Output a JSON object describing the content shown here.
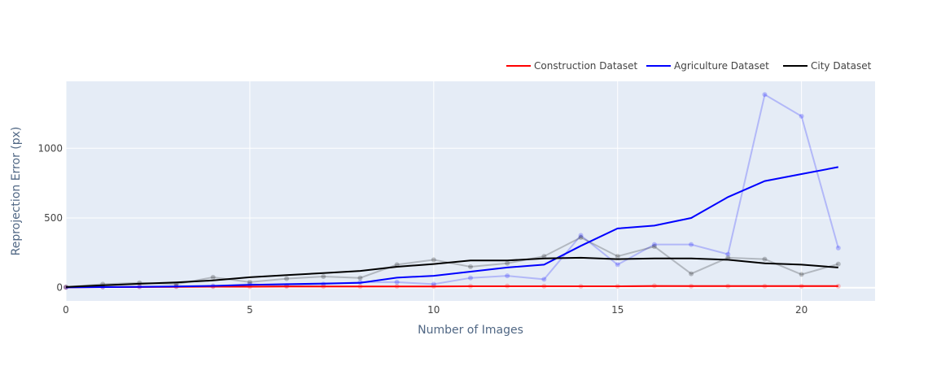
{
  "chart_data": {
    "type": "line",
    "title": "",
    "xlabel": "Number of Images",
    "ylabel": "Reprojection Error (px)",
    "xlim": [
      0,
      22
    ],
    "ylim": [
      -95,
      1480
    ],
    "xticks": [
      0,
      5,
      10,
      15,
      20
    ],
    "yticks": [
      0,
      500,
      1000
    ],
    "grid": true,
    "legend_placement": "top-right, horizontal",
    "colors": {
      "plot_bg": "#E5ECF6",
      "grid": "#FFFFFF",
      "construction": "#FF0000",
      "agriculture": "#0000FF",
      "city": "#000000"
    },
    "x": [
      0,
      1,
      2,
      3,
      4,
      5,
      6,
      7,
      8,
      9,
      10,
      11,
      12,
      13,
      14,
      15,
      16,
      17,
      18,
      19,
      20,
      21
    ],
    "series": [
      {
        "name": "Construction Dataset",
        "color": "#FF0000",
        "raw": [
          3,
          5,
          6,
          7,
          8,
          8,
          9,
          9,
          9,
          10,
          10,
          11,
          12,
          11,
          10,
          10,
          14,
          11,
          11,
          11,
          11,
          11
        ],
        "smoothed": [
          3,
          4,
          5,
          6,
          7,
          7,
          8,
          8,
          8,
          9,
          9,
          10,
          10,
          10,
          10,
          10,
          11,
          11,
          11,
          11,
          11,
          11
        ]
      },
      {
        "name": "Agriculture Dataset",
        "color": "#0000FF",
        "raw": [
          2,
          6,
          8,
          10,
          12,
          25,
          15,
          25,
          40,
          40,
          25,
          70,
          85,
          60,
          375,
          165,
          310,
          310,
          240,
          1385,
          1230,
          285
        ],
        "smoothed": [
          2,
          4,
          6,
          9,
          13,
          20,
          25,
          30,
          35,
          72,
          85,
          115,
          145,
          165,
          300,
          425,
          445,
          500,
          650,
          765,
          815,
          865
        ]
      },
      {
        "name": "City Dataset",
        "color": "#000000",
        "raw": [
          5,
          25,
          35,
          25,
          75,
          40,
          65,
          80,
          70,
          165,
          200,
          150,
          175,
          225,
          360,
          225,
          295,
          100,
          215,
          205,
          95,
          170
        ],
        "smoothed": [
          5,
          17,
          28,
          38,
          52,
          75,
          90,
          105,
          120,
          150,
          170,
          195,
          195,
          210,
          215,
          205,
          210,
          210,
          200,
          175,
          165,
          145
        ]
      }
    ]
  }
}
